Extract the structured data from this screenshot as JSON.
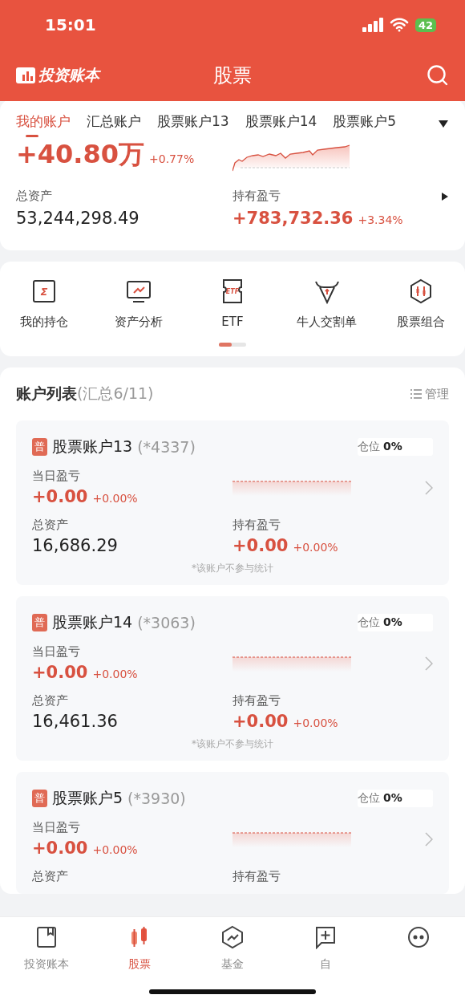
{
  "status_bar": {
    "time": "15:01",
    "battery": "42"
  },
  "header": {
    "logo_text": "投资账本",
    "title": "股票"
  },
  "account_tabs": [
    {
      "label": "我的账户",
      "selected": true
    },
    {
      "label": "汇总账户",
      "selected": false
    },
    {
      "label": "股票账户13",
      "selected": false
    },
    {
      "label": "股票账户14",
      "selected": false
    },
    {
      "label": "股票账户5",
      "selected": false
    }
  ],
  "summary": {
    "today_change": "+40.80万",
    "today_pct": "+0.77%",
    "total_label": "总资产",
    "total_value": "53,244,298.49",
    "holding_label": "持有盈亏",
    "holding_value": "+783,732.36",
    "holding_pct": "+3.34%"
  },
  "shortcuts": [
    {
      "label": "我的持仓",
      "icon_text": "Σ"
    },
    {
      "label": "资产分析"
    },
    {
      "label": "ETF",
      "icon_text": "ETF"
    },
    {
      "label": "牛人交割单"
    },
    {
      "label": "股票组合"
    }
  ],
  "account_list": {
    "title": "账户列表",
    "count": "(汇总6/11)",
    "manage": "管理"
  },
  "accounts": [
    {
      "tag": "普",
      "name": "股票账户13",
      "code": "(*4337)",
      "position_label": "仓位",
      "position_value": "0%",
      "daily_label": "当日盈亏",
      "daily_value": "+0.00",
      "daily_pct": "+0.00%",
      "total_label": "总资产",
      "total_value": "16,686.29",
      "holding_label": "持有盈亏",
      "holding_value": "+0.00",
      "holding_pct": "+0.00%",
      "note": "*该账户不参与统计"
    },
    {
      "tag": "普",
      "name": "股票账户14",
      "code": "(*3063)",
      "position_label": "仓位",
      "position_value": "0%",
      "daily_label": "当日盈亏",
      "daily_value": "+0.00",
      "daily_pct": "+0.00%",
      "total_label": "总资产",
      "total_value": "16,461.36",
      "holding_label": "持有盈亏",
      "holding_value": "+0.00",
      "holding_pct": "+0.00%",
      "note": "*该账户不参与统计"
    },
    {
      "tag": "普",
      "name": "股票账户5",
      "code": "(*3930)",
      "position_label": "仓位",
      "position_value": "0%",
      "daily_label": "当日盈亏",
      "daily_value": "+0.00",
      "daily_pct": "+0.00%",
      "total_label": "总资产",
      "holding_label": "持有盈亏"
    }
  ],
  "bottom_nav": [
    {
      "label": "投资账本",
      "selected": false
    },
    {
      "label": "股票",
      "selected": true
    },
    {
      "label": "基金",
      "selected": false
    },
    {
      "label": "自",
      "selected": false
    },
    {
      "selected": false
    }
  ]
}
